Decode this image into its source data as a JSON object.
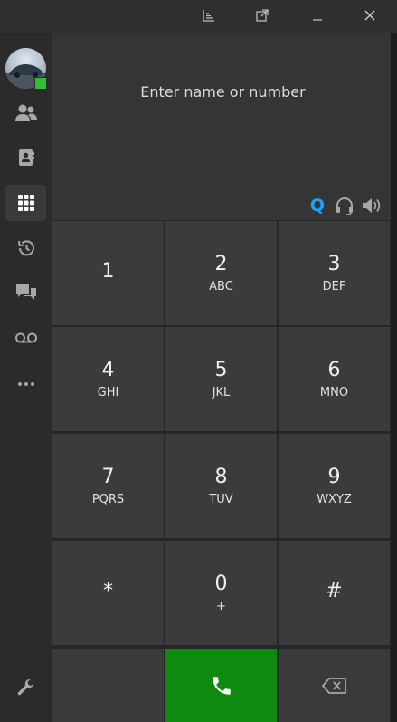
{
  "window": {
    "controls": [
      {
        "name": "reports-icon"
      },
      {
        "name": "popout-icon"
      },
      {
        "name": "minimize-icon"
      },
      {
        "name": "close-icon"
      }
    ]
  },
  "sidebar": {
    "presence_color": "#2fbf2f",
    "items": [
      {
        "icon": "contacts-icon"
      },
      {
        "icon": "address-book-icon"
      },
      {
        "icon": "dialpad-icon",
        "active": true
      },
      {
        "icon": "history-icon"
      },
      {
        "icon": "chat-icon"
      },
      {
        "icon": "voicemail-icon"
      },
      {
        "icon": "more-icon"
      }
    ],
    "settings_icon": "wrench-icon"
  },
  "dialer": {
    "placeholder": "Enter name or number",
    "value": "",
    "queue_label": "Q",
    "queue_color": "#1aa3ff",
    "audio": [
      "headset-icon",
      "speaker-icon"
    ]
  },
  "keypad": {
    "keys": [
      {
        "digit": "1",
        "letters": ""
      },
      {
        "digit": "2",
        "letters": "ABC"
      },
      {
        "digit": "3",
        "letters": "DEF"
      },
      {
        "digit": "4",
        "letters": "GHI"
      },
      {
        "digit": "5",
        "letters": "JKL"
      },
      {
        "digit": "6",
        "letters": "MNO"
      },
      {
        "digit": "7",
        "letters": "PQRS"
      },
      {
        "digit": "8",
        "letters": "TUV"
      },
      {
        "digit": "9",
        "letters": "WXYZ"
      },
      {
        "digit": "*",
        "letters": ""
      },
      {
        "digit": "0",
        "letters": "+"
      },
      {
        "digit": "#",
        "letters": ""
      }
    ],
    "call_color": "#0e8a0e"
  }
}
